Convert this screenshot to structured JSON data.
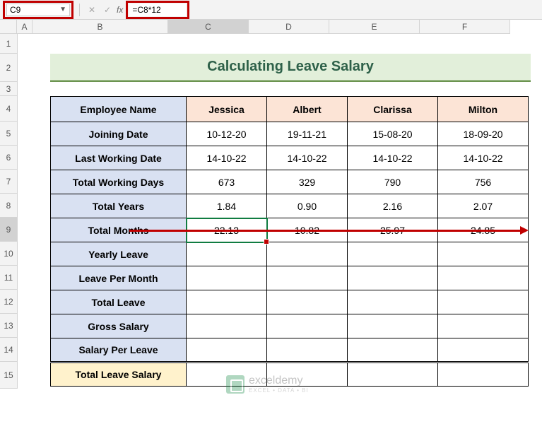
{
  "formula_bar": {
    "name_box": "C9",
    "cancel_symbol": "✕",
    "confirm_symbol": "✓",
    "fx_label": "fx",
    "formula": "=C8*12"
  },
  "columns": [
    "A",
    "B",
    "C",
    "D",
    "E",
    "F"
  ],
  "rows": [
    "1",
    "2",
    "3",
    "4",
    "5",
    "6",
    "7",
    "8",
    "9",
    "10",
    "11",
    "12",
    "13",
    "14",
    "15"
  ],
  "selected_col": "C",
  "selected_row": "9",
  "title": "Calculating Leave Salary",
  "table": {
    "header": [
      "Employee Name",
      "Jessica",
      "Albert",
      "Clarissa",
      "Milton"
    ],
    "rows": [
      {
        "label": "Joining Date",
        "c": "10-12-20",
        "d": "19-11-21",
        "e": "15-08-20",
        "f": "18-09-20"
      },
      {
        "label": "Last Working Date",
        "c": "14-10-22",
        "d": "14-10-22",
        "e": "14-10-22",
        "f": "14-10-22"
      },
      {
        "label": "Total Working Days",
        "c": "673",
        "d": "329",
        "e": "790",
        "f": "756"
      },
      {
        "label": "Total Years",
        "c": "1.84",
        "d": "0.90",
        "e": "2.16",
        "f": "2.07"
      },
      {
        "label": "Total Months",
        "c": "22.13",
        "d": "10.82",
        "e": "25.97",
        "f": "24.85"
      },
      {
        "label": "Yearly Leave",
        "c": "",
        "d": "",
        "e": "",
        "f": ""
      },
      {
        "label": "Leave Per Month",
        "c": "",
        "d": "",
        "e": "",
        "f": ""
      },
      {
        "label": "Total Leave",
        "c": "",
        "d": "",
        "e": "",
        "f": ""
      },
      {
        "label": "Gross Salary",
        "c": "",
        "d": "",
        "e": "",
        "f": ""
      },
      {
        "label": "Salary Per Leave",
        "c": "",
        "d": "",
        "e": "",
        "f": ""
      }
    ],
    "total_row": {
      "label": "Total Leave Salary",
      "c": "",
      "d": "",
      "e": "",
      "f": ""
    }
  },
  "watermark": {
    "brand": "exceldemy",
    "tagline": "EXCEL • DATA • BI"
  },
  "row_heights": {
    "1": 28,
    "2": 40,
    "3": 20,
    "4": 36,
    "5": 34,
    "6": 34,
    "7": 34,
    "8": 34,
    "9": 34,
    "10": 34,
    "11": 34,
    "12": 34,
    "13": 34,
    "14": 34,
    "15": 38
  },
  "col_widths": {
    "A": 22,
    "B": 192,
    "C": 114,
    "D": 114,
    "E": 128,
    "F": 128
  }
}
